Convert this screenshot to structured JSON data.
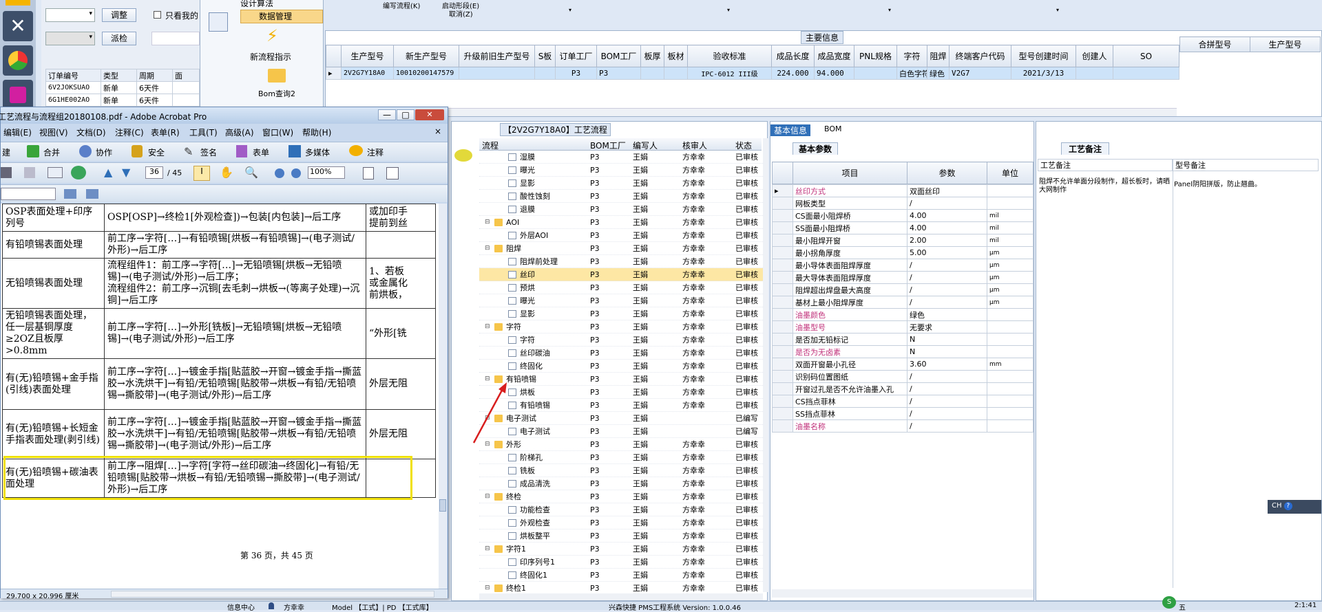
{
  "left_panel": {
    "adjust_btn": "调整",
    "only_mine": "只看我的",
    "dispatch_btn": "派检",
    "cols": [
      "订单编号",
      "类型",
      "周期",
      "面"
    ],
    "rows": [
      [
        "6V2JOKSUAO",
        "新单",
        "6天件"
      ],
      [
        "6G1HE002AO",
        "新单",
        "6天件"
      ]
    ]
  },
  "nav": {
    "design_calc": "设计算法",
    "data_mgmt": "数据管理",
    "new_flow": "新流程指示",
    "bom_query": "Bom查询2"
  },
  "top": {
    "ann1": "编写流程(K)",
    "ann2": "启动形段(E)",
    "ann3": "取消(Z)"
  },
  "main_info": {
    "title": "主要信息",
    "cols": [
      "生产型号",
      "新生产型号",
      "升级前旧生产型号",
      "S板",
      "订单工厂",
      "BOM工厂",
      "板厚",
      "板材",
      "验收标准",
      "成品长度",
      "成品宽度",
      "PNL规格",
      "字符",
      "阻焊",
      "终端客户代码",
      "型号创建时间",
      "创建人",
      "SO"
    ],
    "row": [
      "2V2G7Y18A0",
      "10010200147579",
      "",
      "",
      "P3",
      "P3",
      "",
      "",
      "IPC-6012 III级",
      "224.000",
      "94.000",
      "",
      "白色字符",
      "绿色",
      "V2G7",
      "2021/3/13",
      "",
      ""
    ],
    "right_cols": [
      "合拼型号",
      "生产型号"
    ]
  },
  "acrobat": {
    "title": "工艺流程与流程组20180108.pdf - Adobe Acrobat Pro",
    "menu": [
      "编辑(E)",
      "视图(V)",
      "文档(D)",
      "注释(C)",
      "表单(R)",
      "工具(T)",
      "高级(A)",
      "窗口(W)",
      "帮助(H)"
    ],
    "toolbar": [
      "建",
      "合并",
      "协作",
      "安全",
      "签名",
      "表单",
      "多媒体",
      "注释"
    ],
    "page": "36",
    "pages": "/ 45",
    "zoom": "100%",
    "rows": [
      {
        "name": "OSP表面处理+印序列号",
        "flow": "OSP[OSP]→终检1[外观检查])→包装[内包装]→后工序",
        "note": "或加印手\n提前到丝"
      },
      {
        "name": "有铅喷锡表面处理",
        "flow": "前工序→字符[…]→有铅喷锡[烘板→有铅喷锡]→(电子测试/外形)→后工序",
        "note": ""
      },
      {
        "name": "无铅喷锡表面处理",
        "flow": "流程组件1：前工序→字符[…]→无铅喷锡[烘板→无铅喷锡]→(电子测试/外形)→后工序；\n流程组件2：前工序→沉铜[去毛刺→烘板→(等离子处理)→沉铜]→后工序",
        "note": "1、若板\n或金属化\n前烘板，"
      },
      {
        "name": "无铅喷锡表面处理，任一层基铜厚度≥2OZ且板厚>0.8mm",
        "flow": "前工序→字符[…]→外形[铣板]→无铅喷锡[烘板→无铅喷锡]→(电子测试/外形)→后工序",
        "note": "“外形[铣"
      },
      {
        "name": "有(无)铅喷锡+金手指(引线)表面处理",
        "flow": "前工序→字符[…]→镀金手指[贴蓝胶→开窗→镀金手指→撕蓝胶→水洗烘干]→有铅/无铅喷锡[贴胶带→烘板→有铅/无铅喷锡→撕胶带]→(电子测试/外形)→后工序",
        "note": "外层无阻"
      },
      {
        "name": "有(无)铅喷锡+长短金手指表面处理(剥引线)",
        "flow": "前工序→字符[…]→镀金手指[贴蓝胶→开窗→镀金手指→撕蓝胶→水洗烘干]→有铅/无铅喷锡[贴胶带→烘板→有铅/无铅喷锡→撕胶带]→(电子测试/外形)→后工序",
        "note": "外层无阻"
      },
      {
        "name": "有(无)铅喷锡+碳油表面处理",
        "flow": "前工序→阻焊[…]→字符[字符→丝印碳油→终固化]→有铅/无铅喷锡[贴胶带→烘板→有铅/无铅喷锡→撕胶带]→(电子测试/外形)→后工序",
        "note": ""
      }
    ],
    "footer": "第 36 页，共 45 页",
    "size": "29.700 x 20.996 厘米"
  },
  "flow_panel": {
    "title": "【2V2G7Y18A0】工艺流程",
    "cols": [
      "流程",
      "BOM工厂",
      "编写人",
      "核审人",
      "状态"
    ],
    "rows": [
      {
        "l": 2,
        "t": "f",
        "n": "湿膜",
        "c": [
          "P3",
          "王娟",
          "方幸幸",
          "已审核"
        ]
      },
      {
        "l": 2,
        "t": "f",
        "n": "曝光",
        "c": [
          "P3",
          "王娟",
          "方幸幸",
          "已审核"
        ]
      },
      {
        "l": 2,
        "t": "f",
        "n": "显影",
        "c": [
          "P3",
          "王娟",
          "方幸幸",
          "已审核"
        ]
      },
      {
        "l": 2,
        "t": "f",
        "n": "酸性蚀刻",
        "c": [
          "P3",
          "王娟",
          "方幸幸",
          "已审核"
        ]
      },
      {
        "l": 2,
        "t": "f",
        "n": "退膜",
        "c": [
          "P3",
          "王娟",
          "方幸幸",
          "已审核"
        ]
      },
      {
        "l": 1,
        "t": "d",
        "n": "AOI",
        "c": [
          "P3",
          "王娟",
          "方幸幸",
          "已审核"
        ]
      },
      {
        "l": 2,
        "t": "f",
        "n": "外层AOI",
        "c": [
          "P3",
          "王娟",
          "方幸幸",
          "已审核"
        ]
      },
      {
        "l": 1,
        "t": "d",
        "n": "阻焊",
        "c": [
          "P3",
          "王娟",
          "方幸幸",
          "已审核"
        ]
      },
      {
        "l": 2,
        "t": "f",
        "n": "阻焊前处理",
        "c": [
          "P3",
          "王娟",
          "方幸幸",
          "已审核"
        ]
      },
      {
        "l": 2,
        "t": "f",
        "n": "丝印",
        "c": [
          "P3",
          "王娟",
          "方幸幸",
          "已审核"
        ],
        "sel": true
      },
      {
        "l": 2,
        "t": "f",
        "n": "预烘",
        "c": [
          "P3",
          "王娟",
          "方幸幸",
          "已审核"
        ]
      },
      {
        "l": 2,
        "t": "f",
        "n": "曝光",
        "c": [
          "P3",
          "王娟",
          "方幸幸",
          "已审核"
        ]
      },
      {
        "l": 2,
        "t": "f",
        "n": "显影",
        "c": [
          "P3",
          "王娟",
          "方幸幸",
          "已审核"
        ]
      },
      {
        "l": 1,
        "t": "d",
        "n": "字符",
        "c": [
          "P3",
          "王娟",
          "方幸幸",
          "已审核"
        ]
      },
      {
        "l": 2,
        "t": "f",
        "n": "字符",
        "c": [
          "P3",
          "王娟",
          "方幸幸",
          "已审核"
        ]
      },
      {
        "l": 2,
        "t": "f",
        "n": "丝印碳油",
        "c": [
          "P3",
          "王娟",
          "方幸幸",
          "已审核"
        ]
      },
      {
        "l": 2,
        "t": "f",
        "n": "终固化",
        "c": [
          "P3",
          "王娟",
          "方幸幸",
          "已审核"
        ]
      },
      {
        "l": 1,
        "t": "d",
        "n": "有铅喷锡",
        "c": [
          "P3",
          "王娟",
          "方幸幸",
          "已审核"
        ]
      },
      {
        "l": 2,
        "t": "f",
        "n": "烘板",
        "c": [
          "P3",
          "王娟",
          "方幸幸",
          "已审核"
        ]
      },
      {
        "l": 2,
        "t": "f",
        "n": "有铅喷锡",
        "c": [
          "P3",
          "王娟",
          "方幸幸",
          "已审核"
        ]
      },
      {
        "l": 1,
        "t": "d",
        "n": "电子测试",
        "c": [
          "P3",
          "王娟",
          "",
          "已编写"
        ]
      },
      {
        "l": 2,
        "t": "f",
        "n": "电子测试",
        "c": [
          "P3",
          "王娟",
          "",
          "已编写"
        ]
      },
      {
        "l": 1,
        "t": "d",
        "n": "外形",
        "c": [
          "P3",
          "王娟",
          "方幸幸",
          "已审核"
        ]
      },
      {
        "l": 2,
        "t": "f",
        "n": "阶梯孔",
        "c": [
          "P3",
          "王娟",
          "方幸幸",
          "已审核"
        ]
      },
      {
        "l": 2,
        "t": "f",
        "n": "铣板",
        "c": [
          "P3",
          "王娟",
          "方幸幸",
          "已审核"
        ]
      },
      {
        "l": 2,
        "t": "f",
        "n": "成品清洗",
        "c": [
          "P3",
          "王娟",
          "方幸幸",
          "已审核"
        ]
      },
      {
        "l": 1,
        "t": "d",
        "n": "终检",
        "c": [
          "P3",
          "王娟",
          "方幸幸",
          "已审核"
        ]
      },
      {
        "l": 2,
        "t": "f",
        "n": "功能检查",
        "c": [
          "P3",
          "王娟",
          "方幸幸",
          "已审核"
        ]
      },
      {
        "l": 2,
        "t": "f",
        "n": "外观检查",
        "c": [
          "P3",
          "王娟",
          "方幸幸",
          "已审核"
        ]
      },
      {
        "l": 2,
        "t": "f",
        "n": "烘板整平",
        "c": [
          "P3",
          "王娟",
          "方幸幸",
          "已审核"
        ]
      },
      {
        "l": 1,
        "t": "d",
        "n": "字符1",
        "c": [
          "P3",
          "王娟",
          "方幸幸",
          "已审核"
        ]
      },
      {
        "l": 2,
        "t": "f",
        "n": "印序列号1",
        "c": [
          "P3",
          "王娟",
          "方幸幸",
          "已审核"
        ]
      },
      {
        "l": 2,
        "t": "f",
        "n": "终固化1",
        "c": [
          "P3",
          "王娟",
          "方幸幸",
          "已审核"
        ]
      },
      {
        "l": 1,
        "t": "d",
        "n": "终检1",
        "c": [
          "P3",
          "王娟",
          "方幸幸",
          "已审核"
        ]
      }
    ]
  },
  "params": {
    "tab1": "基本信息",
    "tab2": "BOM",
    "section": "基本参数",
    "cols": [
      "项目",
      "参数",
      "单位"
    ],
    "rows": [
      {
        "k": "丝印方式",
        "v": "双面丝印",
        "u": "",
        "m": true
      },
      {
        "k": "网板类型",
        "v": "/",
        "u": ""
      },
      {
        "k": "CS面最小阻焊桥",
        "v": "4.00",
        "u": "mil"
      },
      {
        "k": "SS面最小阻焊桥",
        "v": "4.00",
        "u": "mil"
      },
      {
        "k": "最小阻焊开窗",
        "v": "2.00",
        "u": "mil"
      },
      {
        "k": "最小拐角厚度",
        "v": "5.00",
        "u": "μm"
      },
      {
        "k": "最小导体表面阻焊厚度",
        "v": "/",
        "u": "μm"
      },
      {
        "k": "最大导体表面阻焊厚度",
        "v": "/",
        "u": "μm"
      },
      {
        "k": "阻焊超出焊盘最大高度",
        "v": "/",
        "u": "μm"
      },
      {
        "k": "基材上最小阻焊厚度",
        "v": "/",
        "u": "μm"
      },
      {
        "k": "油墨颜色",
        "v": "绿色",
        "u": "",
        "m": true
      },
      {
        "k": "油墨型号",
        "v": "无要求",
        "u": "",
        "m": true
      },
      {
        "k": "是否加无铅标记",
        "v": "N",
        "u": ""
      },
      {
        "k": "是否为无卤素",
        "v": "N",
        "u": "",
        "m": true
      },
      {
        "k": "双面开窗最小孔径",
        "v": "3.60",
        "u": "mm"
      },
      {
        "k": "识别码位置图纸",
        "v": "/",
        "u": ""
      },
      {
        "k": "开窗过孔是否不允许油墨入孔",
        "v": "/",
        "u": ""
      },
      {
        "k": "CS挡点菲林",
        "v": "/",
        "u": ""
      },
      {
        "k": "SS挡点菲林",
        "v": "/",
        "u": ""
      },
      {
        "k": "油墨名称",
        "v": "/",
        "u": "",
        "m": true
      }
    ]
  },
  "notes": {
    "title": "工艺备注",
    "col1": "工艺备注",
    "col2": "型号备注",
    "text1": "阻焊不允许单面分段制作，超长板时，请晒大网制作",
    "text2": "Panel阴阳拼版，防止翘曲。"
  },
  "status": {
    "left1": "信息中心",
    "left2": "方幸幸",
    "mid": "Model 【工式】| PD 【工式库】",
    "app": "兴森快捷 PMS工程系统 Version: 1.0.0.46",
    "time": "2:1:41",
    "ime": "CH",
    "tray": "五"
  },
  "colors": {
    "accent": "#2f6fb8",
    "highlight": "#fff3a8",
    "pink": "#c0307a",
    "yellow_box": "#f0e000",
    "arrow": "#d81e1e"
  }
}
